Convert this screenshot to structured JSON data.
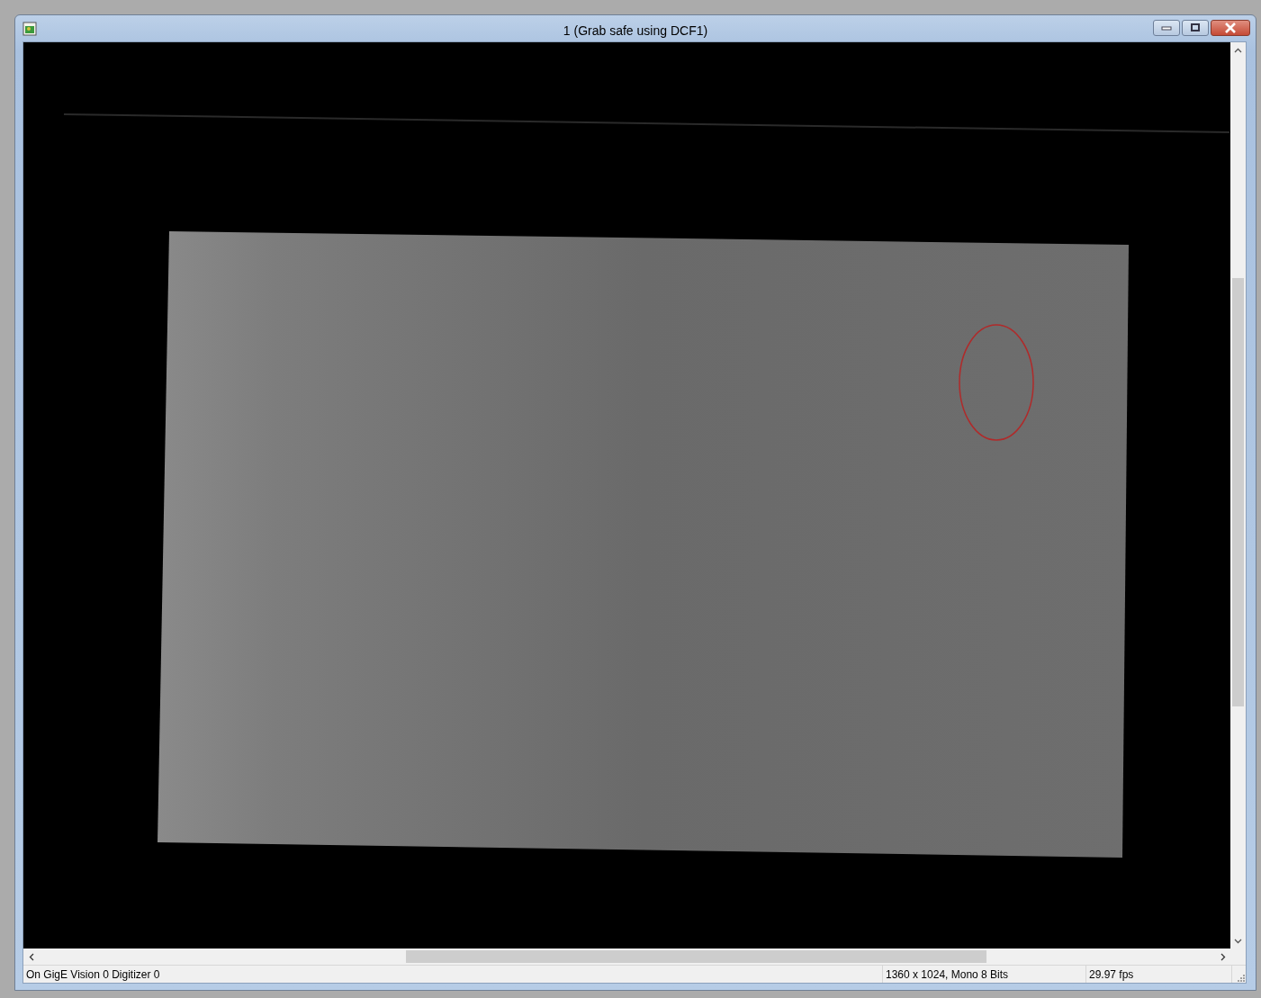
{
  "window": {
    "title": "1 (Grab safe using DCF1)"
  },
  "status_bar": [
    {
      "text": "On GigE Vision 0 Digitizer 0"
    },
    {
      "text": "1360 x 1024, Mono 8 Bits"
    },
    {
      "text": "29.97 fps"
    }
  ]
}
